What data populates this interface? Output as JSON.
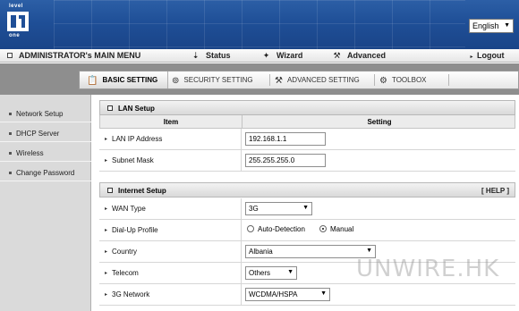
{
  "logo": {
    "top_text": "level",
    "bottom_text": "one"
  },
  "language": {
    "selected": "English"
  },
  "menubar": {
    "title": "ADMINISTRATOR's MAIN MENU",
    "status": "Status",
    "wizard": "Wizard",
    "advanced": "Advanced",
    "logout": "Logout"
  },
  "tabs": [
    {
      "label": "BASIC SETTING",
      "icon": "basic-setting-icon"
    },
    {
      "label": "SECURITY SETTING",
      "icon": "security-setting-icon"
    },
    {
      "label": "ADVANCED SETTING",
      "icon": "advanced-setting-icon"
    },
    {
      "label": "TOOLBOX",
      "icon": "toolbox-icon"
    }
  ],
  "sidebar": {
    "items": [
      {
        "label": "Network Setup"
      },
      {
        "label": "DHCP Server"
      },
      {
        "label": "Wireless"
      },
      {
        "label": "Change Password"
      }
    ]
  },
  "lan": {
    "title": "LAN Setup",
    "col_item": "Item",
    "col_setting": "Setting",
    "ip_label": "LAN IP Address",
    "ip_value": "192.168.1.1",
    "mask_label": "Subnet Mask",
    "mask_value": "255.255.255.0"
  },
  "internet": {
    "title": "Internet Setup",
    "help": "[ HELP ]",
    "wan_label": "WAN Type",
    "wan_value": "3G",
    "dialup_label": "Dial-Up Profile",
    "dialup_auto": "Auto-Detection",
    "dialup_manual": "Manual",
    "dialup_selected": "Manual",
    "country_label": "Country",
    "country_value": "Albania",
    "telecom_label": "Telecom",
    "telecom_value": "Others",
    "network_label": "3G Network",
    "network_value": "WCDMA/HSPA"
  },
  "watermark": "UNWIRE.HK",
  "colors": {
    "header_blue": "#1f4f97",
    "band_gray": "#8e8e8e",
    "sidebar_gray": "#dadada"
  }
}
